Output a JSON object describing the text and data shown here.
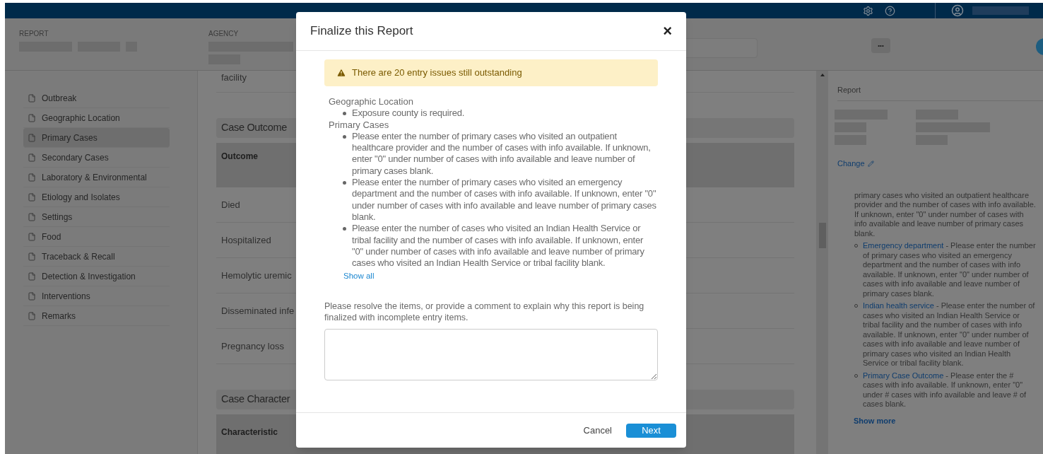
{
  "header": {
    "fields": [
      {
        "label": "REPORT"
      },
      {
        "label": "AGENCY"
      }
    ],
    "more_button": "•••"
  },
  "sidebar": {
    "items": [
      {
        "label": "Outbreak",
        "selected": false
      },
      {
        "label": "Geographic Location",
        "selected": false
      },
      {
        "label": "Primary Cases",
        "selected": true
      },
      {
        "label": "Secondary Cases",
        "selected": false
      },
      {
        "label": "Laboratory & Environmental",
        "selected": false
      },
      {
        "label": "Etiology and Isolates",
        "selected": false
      },
      {
        "label": "Settings",
        "selected": false
      },
      {
        "label": "Food",
        "selected": false
      },
      {
        "label": "Traceback & Recall",
        "selected": false
      },
      {
        "label": "Detection & Investigation",
        "selected": false
      },
      {
        "label": "Interventions",
        "selected": false
      },
      {
        "label": "Remarks",
        "selected": false
      }
    ]
  },
  "main": {
    "partial_text": "facility",
    "sections": [
      {
        "title": "Case Outcome",
        "column_header": "Outcome",
        "rows": [
          "Died",
          "Hospitalized",
          "Hemolytic uremic",
          "Disseminated infe",
          "Pregnancy loss"
        ]
      },
      {
        "title": "Case Character",
        "column_header": "Characteristic"
      }
    ]
  },
  "right_panel": {
    "title": "Report",
    "change_link": "Change",
    "issues": [
      {
        "kind": "continued",
        "text": "primary cases who visited an outpatient healthcare provider and the number of cases with info available. If unknown, enter \"0\" under number of cases with info available and leave number of primary cases blank."
      },
      {
        "kind": "item",
        "link": "Emergency department",
        "text": " - Please enter the number of primary cases who visited an emergency department and the number of cases with info available. If unknown, enter \"0\" under number of cases with info available and leave number of primary cases blank."
      },
      {
        "kind": "item",
        "link": "Indian health service",
        "text": " - Please enter the number of cases who visited an Indian Health Service or tribal facility and the number of cases with info available. If unknown, enter \"0\" under number of cases with info available and leave number of primary cases who visited an Indian Health Service or tribal facility blank."
      },
      {
        "kind": "item",
        "link": "Primary Case Outcome",
        "text": " - Please enter the # cases with info available. If unknown, enter \"0\" under # cases with info available and leave # of cases blank."
      }
    ],
    "show_more": "Show more"
  },
  "modal": {
    "title": "Finalize this Report",
    "close": "×",
    "alert": "There are 20 entry issues still outstanding",
    "groups": [
      {
        "title": "Geographic Location",
        "items": [
          "Exposure county is required."
        ]
      },
      {
        "title": "Primary Cases",
        "items": [
          "Please enter the number of primary cases who visited an outpatient healthcare provider and the number of cases with info available. If unknown, enter \"0\" under number of cases with info available and leave number of primary cases blank.",
          "Please enter the number of primary cases who visited an emergency department and the number of cases with info available. If unknown, enter \"0\" under number of cases with info available and leave number of primary cases blank.",
          "Please enter the number of cases who visited an Indian Health Service or tribal facility and the number of cases with info available. If unknown, enter \"0\" under number of cases with info available and leave number of primary cases who visited an Indian Health Service or tribal facility blank."
        ]
      }
    ],
    "show_all": "Show all",
    "prompt": "Please resolve the items, or provide a comment to explain why this report is being finalized with incomplete entry items.",
    "buttons": [
      {
        "kind": "secondary",
        "label": "Cancel"
      },
      {
        "kind": "primary",
        "label": "Next"
      }
    ]
  }
}
